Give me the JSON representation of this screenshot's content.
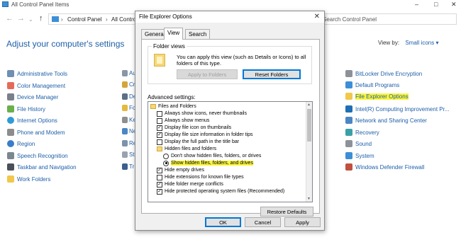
{
  "window": {
    "title": "All Control Panel Items",
    "breadcrumbs": [
      "Control Panel",
      "All Control Panel Items"
    ],
    "search_placeholder": "Search Control Panel"
  },
  "main": {
    "heading": "Adjust your computer's settings",
    "view_by_label": "View by:",
    "view_by_value": "Small icons"
  },
  "left_items": [
    "Administrative Tools",
    "Color Management",
    "Device Manager",
    "File History",
    "Internet Options",
    "Phone and Modem",
    "Region",
    "Speech Recognition",
    "Taskbar and Navigation",
    "Work Folders"
  ],
  "middle_items": [
    "Au",
    "Cr",
    "De",
    "Fo",
    "Ke",
    "Ne",
    "Re",
    "St",
    "Tr"
  ],
  "right_items": [
    "BitLocker Drive Encryption",
    "Default Programs",
    "File Explorer Options",
    "Intel(R) Computing Improvement Pr...",
    "Network and Sharing Center",
    "Recovery",
    "Sound",
    "System",
    "Windows Defender Firewall"
  ],
  "highlight_color": "#fbf53c",
  "dialog": {
    "title": "File Explorer Options",
    "tabs": [
      "General",
      "View",
      "Search"
    ],
    "active_tab": "View",
    "folder_views": {
      "label": "Folder views",
      "description": "You can apply this view (such as Details or Icons) to all folders of this type.",
      "apply_button": "Apply to Folders",
      "reset_button": "Reset Folders"
    },
    "advanced_label": "Advanced settings:",
    "tree": [
      {
        "type": "folder",
        "label": "Files and Folders"
      },
      {
        "type": "check",
        "checked": false,
        "label": "Always show icons, never thumbnails"
      },
      {
        "type": "check",
        "checked": false,
        "label": "Always show menus"
      },
      {
        "type": "check",
        "checked": true,
        "label": "Display file icon on thumbnails"
      },
      {
        "type": "check",
        "checked": true,
        "label": "Display file size information in folder tips"
      },
      {
        "type": "check",
        "checked": false,
        "label": "Display the full path in the title bar"
      },
      {
        "type": "folder",
        "label": "Hidden files and folders"
      },
      {
        "type": "radio",
        "checked": false,
        "label": "Don't show hidden files, folders, or drives"
      },
      {
        "type": "radio",
        "checked": true,
        "label": "Show hidden files, folders, and drives"
      },
      {
        "type": "check",
        "checked": true,
        "label": "Hide empty drives"
      },
      {
        "type": "check",
        "checked": false,
        "label": "Hide extensions for known file types"
      },
      {
        "type": "check",
        "checked": true,
        "label": "Hide folder merge conflicts"
      },
      {
        "type": "check",
        "checked": true,
        "label": "Hide protected operating system files (Recommended)"
      }
    ],
    "restore_button": "Restore Defaults",
    "ok_button": "OK",
    "cancel_button": "Cancel",
    "apply_button": "Apply"
  }
}
